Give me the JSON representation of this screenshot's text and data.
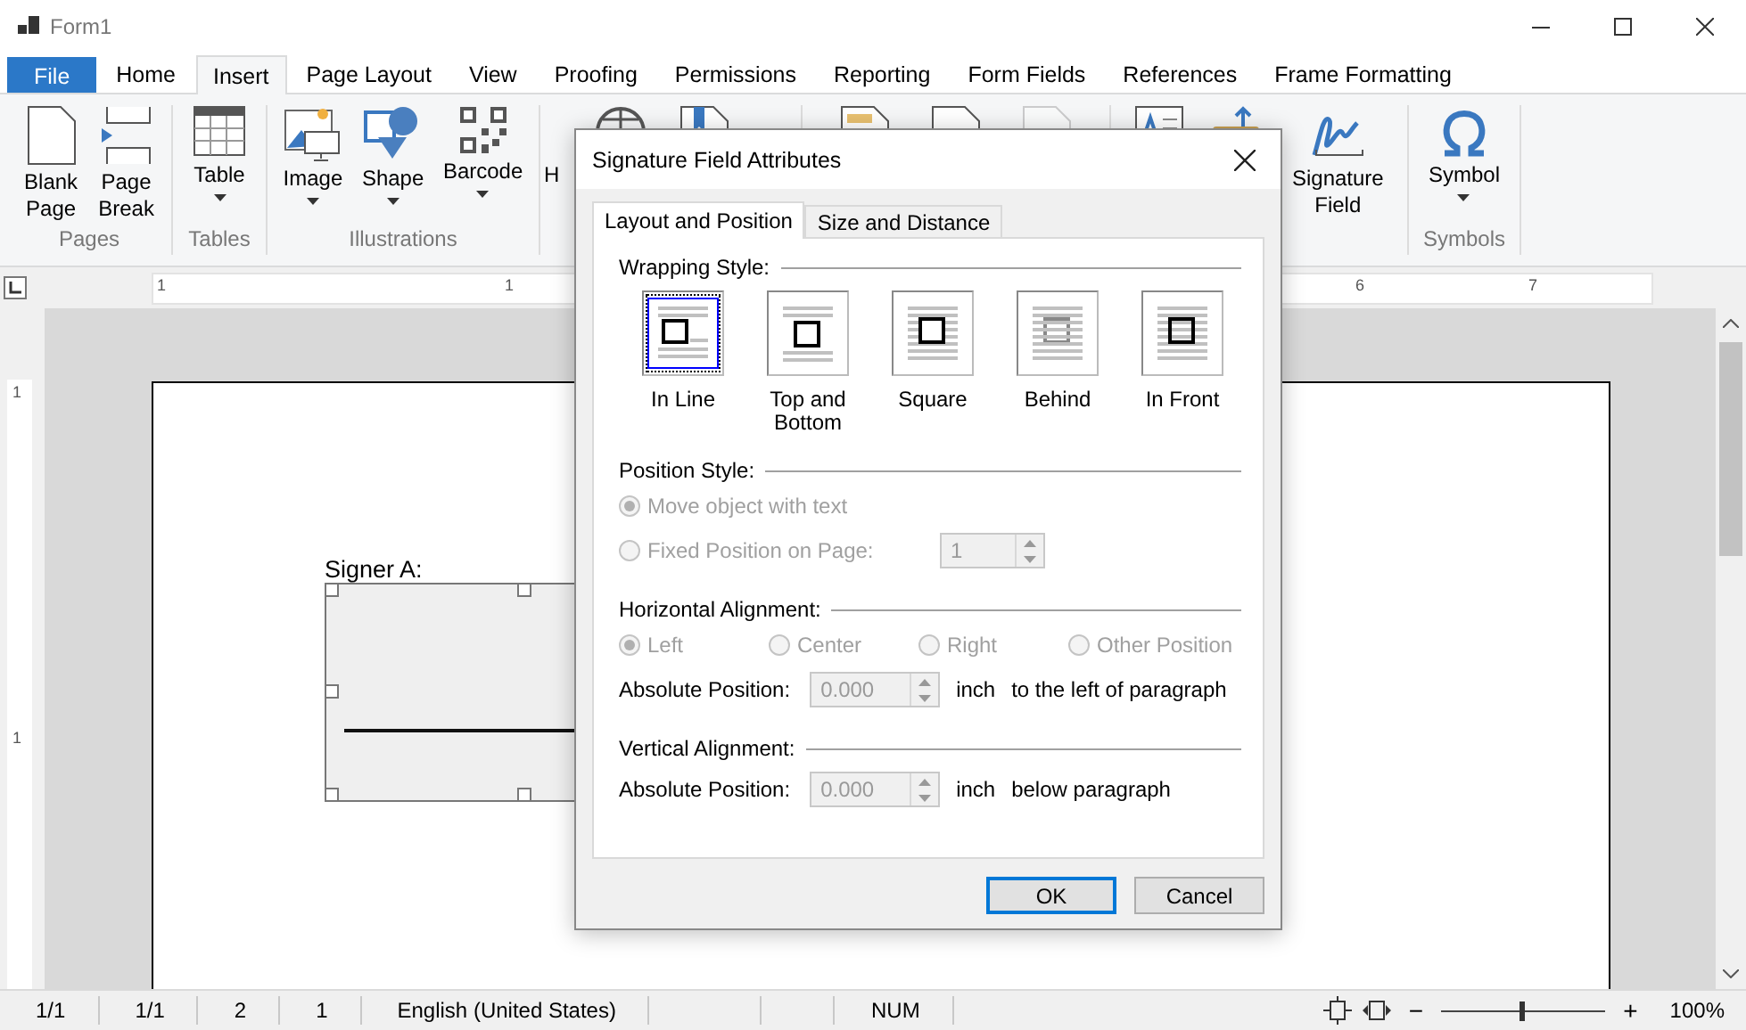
{
  "window": {
    "title": "Form1"
  },
  "menu_tabs": [
    {
      "label": "File",
      "kind": "file",
      "selected": false
    },
    {
      "label": "Home",
      "kind": "tab",
      "selected": false
    },
    {
      "label": "Insert",
      "kind": "tab",
      "selected": true
    },
    {
      "label": "Page Layout",
      "kind": "tab",
      "selected": false
    },
    {
      "label": "View",
      "kind": "tab",
      "selected": false
    },
    {
      "label": "Proofing",
      "kind": "tab",
      "selected": false
    },
    {
      "label": "Permissions",
      "kind": "tab",
      "selected": false
    },
    {
      "label": "Reporting",
      "kind": "tab",
      "selected": false
    },
    {
      "label": "Form Fields",
      "kind": "tab",
      "selected": false
    },
    {
      "label": "References",
      "kind": "tab",
      "selected": false
    },
    {
      "label": "Frame Formatting",
      "kind": "tab",
      "selected": false
    }
  ],
  "ribbon": [
    {
      "label": "Pages",
      "buttons": [
        {
          "label": "Blank Page"
        },
        {
          "label": "Page Break"
        }
      ]
    },
    {
      "label": "Tables",
      "buttons": [
        {
          "label": "Table",
          "dropdown": true
        }
      ]
    },
    {
      "label": "Illustrations",
      "buttons": [
        {
          "label": "Image",
          "dropdown": true
        },
        {
          "label": "Shape",
          "dropdown": true
        },
        {
          "label": "Barcode",
          "dropdown": true
        }
      ]
    },
    {
      "buttons": [
        {
          "label": "H"
        },
        {
          "disabled": false
        }
      ]
    },
    {
      "buttons": [
        {
          "disabled": false
        },
        {
          "disabled": false
        },
        {
          "disabled": true
        }
      ]
    },
    {
      "buttons": [
        {
          "disabled": false
        },
        {
          "disabled": false
        },
        {
          "label": "Signature Field"
        }
      ]
    },
    {
      "label": "Symbols",
      "buttons": [
        {
          "label": "Symbol",
          "dropdown": true
        }
      ]
    }
  ],
  "ruler": {
    "horizontal_labels": [
      "1",
      "1",
      "6",
      "7"
    ],
    "vertical_labels": [
      "1",
      "1"
    ]
  },
  "document": {
    "label": "Signer A:"
  },
  "status_bar": {
    "cells": [
      "1/1",
      "1/1",
      "2",
      "1",
      "English (United States)",
      "NUM"
    ],
    "zoom": {
      "minus": "−",
      "plus": "+",
      "level": 0.48,
      "reading": "100%"
    }
  },
  "dialog": {
    "title": "Signature Field Attributes",
    "tabs": [
      {
        "label": "Layout and Position",
        "selected": true
      },
      {
        "label": "Size and Distance",
        "selected": false
      }
    ],
    "wrapping": {
      "heading": "Wrapping Style:",
      "options": [
        {
          "label": "In Line",
          "selected": true
        },
        {
          "label": "Top and Bottom",
          "selected": false
        },
        {
          "label": "Square",
          "selected": false
        },
        {
          "label": "Behind",
          "selected": false
        },
        {
          "label": "In Front",
          "selected": false
        }
      ]
    },
    "position": {
      "heading": "Position Style:",
      "options": [
        {
          "label": "Move object with text",
          "selected": true,
          "disabled": true
        },
        {
          "label": "Fixed Position on Page:",
          "selected": false,
          "disabled": true
        }
      ],
      "page_value": "1"
    },
    "horizontal": {
      "heading": "Horizontal Alignment:",
      "options": [
        {
          "label": "Left",
          "selected": true,
          "disabled": true
        },
        {
          "label": "Center",
          "selected": false,
          "disabled": true
        },
        {
          "label": "Right",
          "selected": false,
          "disabled": true
        },
        {
          "label": "Other Position",
          "selected": false,
          "disabled": true
        }
      ],
      "position_label": "Absolute Position:",
      "value": "0.000",
      "unit": "inch",
      "suffix": "to the left of paragraph"
    },
    "vertical": {
      "heading": "Vertical Alignment:",
      "position_label": "Absolute Position:",
      "value": "0.000",
      "unit": "inch",
      "suffix": "below paragraph"
    },
    "buttons": [
      {
        "label": "OK",
        "default": true
      },
      {
        "label": "Cancel",
        "default": false
      }
    ]
  }
}
